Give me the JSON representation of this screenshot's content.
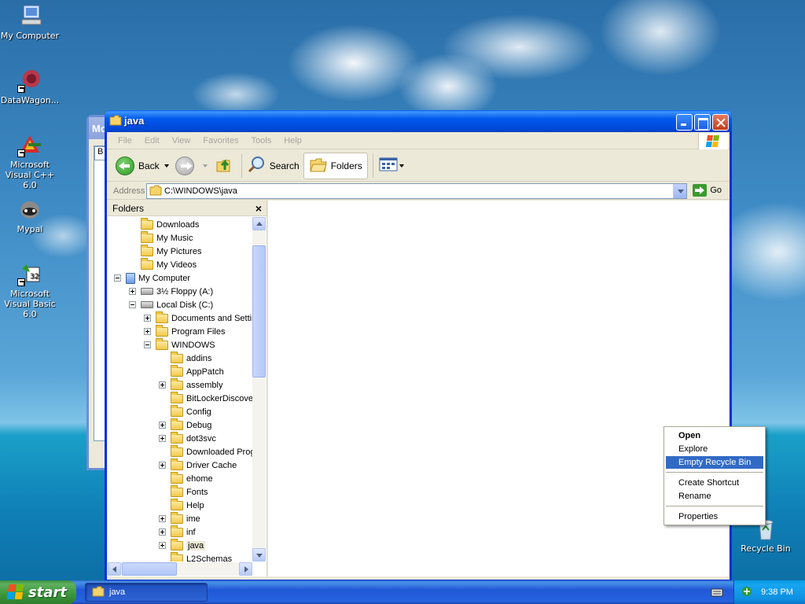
{
  "desktop": {
    "icons": [
      {
        "label": "My Computer",
        "icon": "my-computer-icon"
      },
      {
        "label": "DataWagon...",
        "icon": "datawagon-icon"
      },
      {
        "label": "Microsoft Visual C++ 6.0",
        "icon": "visual-cpp-icon"
      },
      {
        "label": "Mypal",
        "icon": "mypal-icon"
      },
      {
        "label": "Microsoft Visual Basic 6.0",
        "icon": "visual-basic-icon"
      }
    ],
    "recycle_bin_label": "Recycle Bin",
    "behind_window_title": "Mo",
    "behind_window_label": "B"
  },
  "window": {
    "title": "java",
    "menu": [
      "File",
      "Edit",
      "View",
      "Favorites",
      "Tools",
      "Help"
    ],
    "toolbar": {
      "back_label": "Back",
      "search_label": "Search",
      "folders_label": "Folders"
    },
    "address": {
      "label": "Address",
      "value": "C:\\WINDOWS\\java",
      "go_label": "Go"
    },
    "folders_pane": {
      "title": "Folders",
      "close_glyph": "×",
      "tree": [
        {
          "label": "Downloads",
          "level": 2,
          "expander": "none",
          "icon": "folder"
        },
        {
          "label": "My Music",
          "level": 2,
          "expander": "none",
          "icon": "folder"
        },
        {
          "label": "My Pictures",
          "level": 2,
          "expander": "none",
          "icon": "folder"
        },
        {
          "label": "My Videos",
          "level": 2,
          "expander": "none",
          "icon": "folder"
        },
        {
          "label": "My Computer",
          "level": 1,
          "expander": "minus",
          "icon": "computer"
        },
        {
          "label": "3½ Floppy (A:)",
          "level": 2,
          "expander": "plus",
          "icon": "drive"
        },
        {
          "label": "Local Disk (C:)",
          "level": 2,
          "expander": "minus",
          "icon": "drive"
        },
        {
          "label": "Documents and Settin",
          "level": 3,
          "expander": "plus",
          "icon": "folder"
        },
        {
          "label": "Program Files",
          "level": 3,
          "expander": "plus",
          "icon": "folder"
        },
        {
          "label": "WINDOWS",
          "level": 3,
          "expander": "minus",
          "icon": "folder"
        },
        {
          "label": "addins",
          "level": 4,
          "expander": "none",
          "icon": "folder"
        },
        {
          "label": "AppPatch",
          "level": 4,
          "expander": "none",
          "icon": "folder"
        },
        {
          "label": "assembly",
          "level": 4,
          "expander": "plus",
          "icon": "folder"
        },
        {
          "label": "BitLockerDiscover",
          "level": 4,
          "expander": "none",
          "icon": "folder"
        },
        {
          "label": "Config",
          "level": 4,
          "expander": "none",
          "icon": "folder"
        },
        {
          "label": "Debug",
          "level": 4,
          "expander": "plus",
          "icon": "folder"
        },
        {
          "label": "dot3svc",
          "level": 4,
          "expander": "plus",
          "icon": "folder"
        },
        {
          "label": "Downloaded Prog",
          "level": 4,
          "expander": "none",
          "icon": "folder"
        },
        {
          "label": "Driver Cache",
          "level": 4,
          "expander": "plus",
          "icon": "folder"
        },
        {
          "label": "ehome",
          "level": 4,
          "expander": "none",
          "icon": "folder"
        },
        {
          "label": "Fonts",
          "level": 4,
          "expander": "none",
          "icon": "folder"
        },
        {
          "label": "Help",
          "level": 4,
          "expander": "none",
          "icon": "folder"
        },
        {
          "label": "ime",
          "level": 4,
          "expander": "plus",
          "icon": "folder"
        },
        {
          "label": "inf",
          "level": 4,
          "expander": "plus",
          "icon": "folder"
        },
        {
          "label": "java",
          "level": 4,
          "expander": "plus",
          "icon": "folder",
          "selected": true
        },
        {
          "label": "L2Schemas",
          "level": 4,
          "expander": "none",
          "icon": "folder"
        }
      ]
    }
  },
  "context_menu": {
    "items": [
      {
        "label": "Open",
        "bold": true
      },
      {
        "label": "Explore"
      },
      {
        "label": "Empty Recycle Bin",
        "highlighted": true
      },
      {
        "separator": true
      },
      {
        "label": "Create Shortcut"
      },
      {
        "label": "Rename"
      },
      {
        "separator": true
      },
      {
        "label": "Properties"
      }
    ]
  },
  "taskbar": {
    "start_label": "start",
    "tasks": [
      {
        "label": "java",
        "icon": "folder-icon"
      }
    ],
    "clock": "9:38 PM"
  },
  "colors": {
    "titlebar": "#0058ee",
    "highlight": "#316ac5",
    "start": "#3a963a"
  }
}
